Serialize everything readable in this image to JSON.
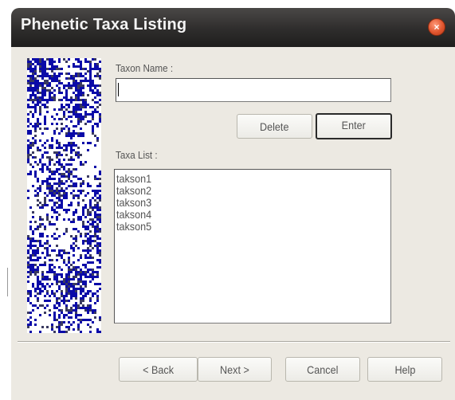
{
  "window": {
    "title": "Phenetic Taxa Listing",
    "close_icon": "×"
  },
  "form": {
    "taxon_name_label": "Taxon Name :",
    "taxon_name_value": "",
    "delete_label": "Delete",
    "enter_label": "Enter",
    "taxa_list_label": "Taxa List :",
    "taxa": [
      "takson1",
      "takson2",
      "takson3",
      "takson4",
      "takson5"
    ]
  },
  "footer": {
    "back_label": "< Back",
    "next_label": "Next >",
    "cancel_label": "Cancel",
    "help_label": "Help"
  },
  "colors": {
    "titlebar": "#2e2d2c",
    "dialog_bg": "#ece9e2",
    "close_button": "#e0552e",
    "picture_blue": "#0a0aa8"
  }
}
